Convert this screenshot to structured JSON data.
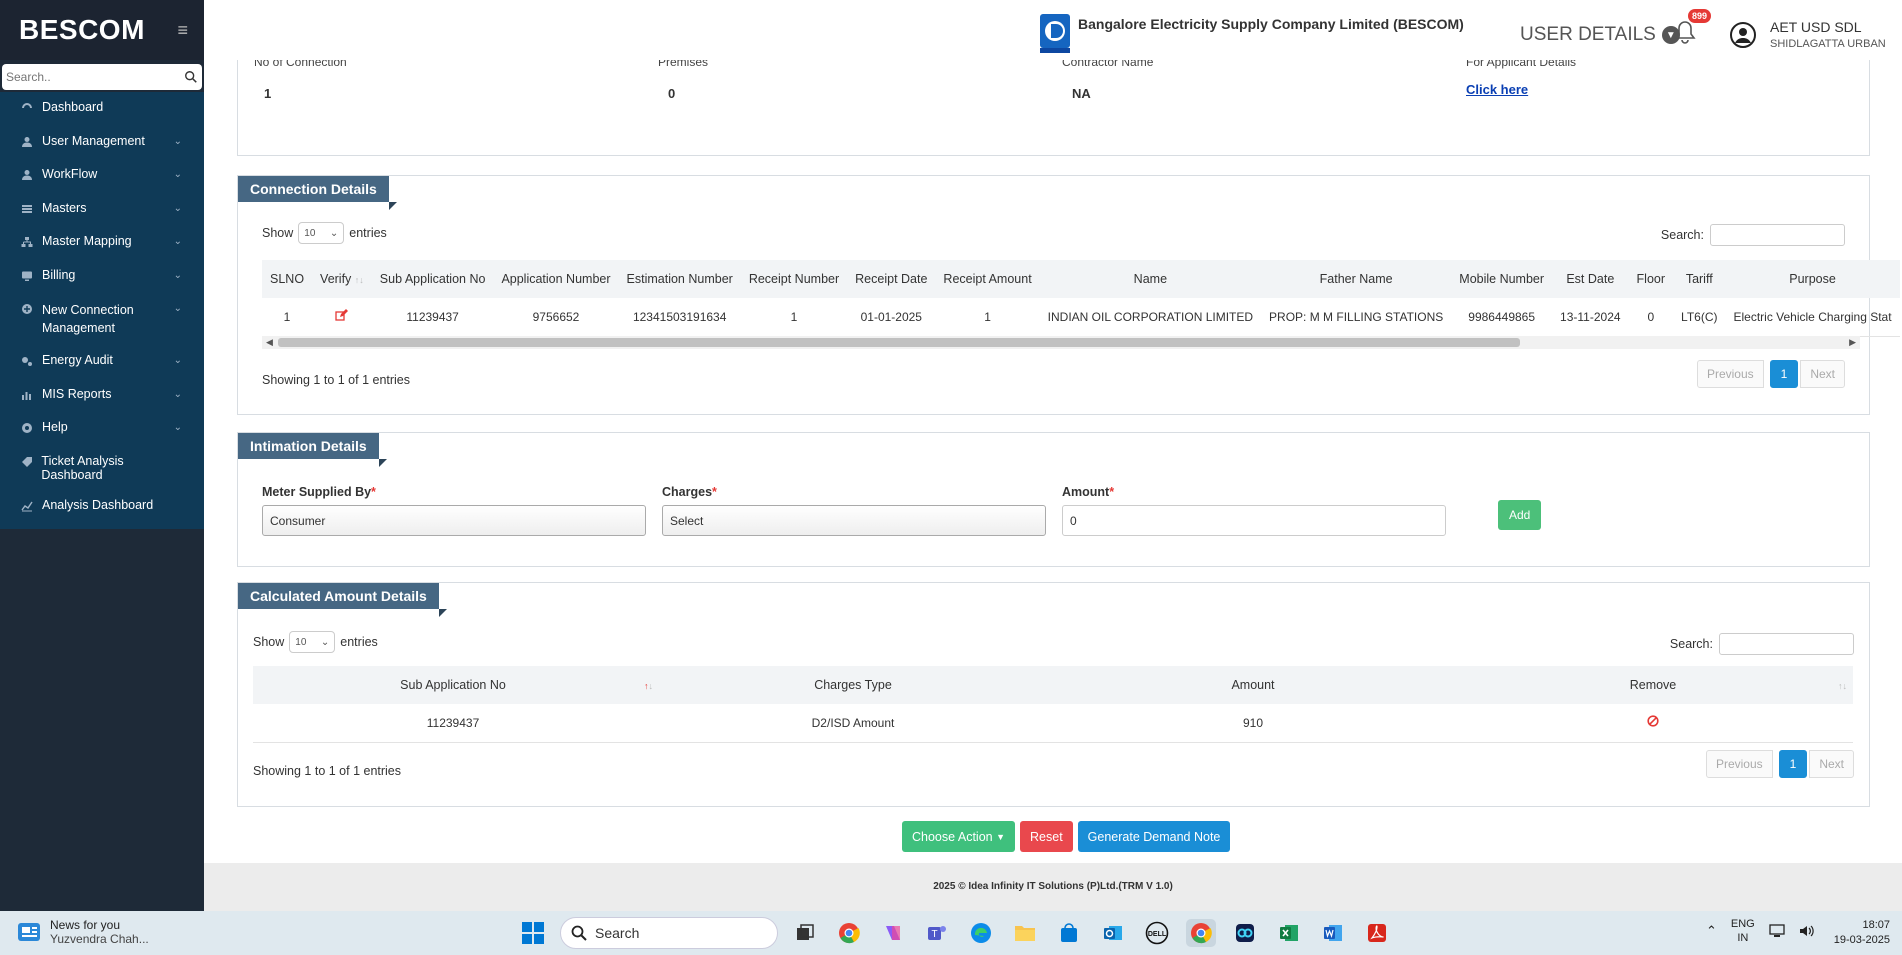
{
  "sidebar": {
    "brand": "BESCOM",
    "search_placeholder": "Search..",
    "items": [
      {
        "label": "Dashboard",
        "icon": "dashboard-icon",
        "chevron": false
      },
      {
        "label": "User Management",
        "icon": "user-icon",
        "chevron": true
      },
      {
        "label": "WorkFlow",
        "icon": "user-icon",
        "chevron": true
      },
      {
        "label": "Masters",
        "icon": "list-icon",
        "chevron": true
      },
      {
        "label": "Master Mapping",
        "icon": "sitemap-icon",
        "chevron": true
      },
      {
        "label": "Billing",
        "icon": "monitor-icon",
        "chevron": true
      },
      {
        "label": "New Connection Management",
        "icon": "plus-circle-icon",
        "chevron": true
      },
      {
        "label": "Energy Audit",
        "icon": "cogs-icon",
        "chevron": true
      },
      {
        "label": "MIS Reports",
        "icon": "bar-chart-icon",
        "chevron": true
      },
      {
        "label": "Help",
        "icon": "help-icon",
        "chevron": true
      },
      {
        "label": "Ticket Analysis Dashboard",
        "icon": "tag-icon",
        "chevron": false
      },
      {
        "label": "Analysis Dashboard",
        "icon": "line-chart-icon",
        "chevron": false
      }
    ]
  },
  "header": {
    "company": "Bangalore Electricity Supply Company Limited (BESCOM)",
    "user_details": "USER DETAILS",
    "notification_count": "899",
    "user_name": "AET USD SDL",
    "user_location": "SHIDLAGATTA URBAN"
  },
  "info": {
    "no_of_connection_label": "No of Connection",
    "no_of_connection": "1",
    "premises_label": "Premises",
    "premises": "0",
    "contractor_label": "Contractor Name",
    "contractor": "NA",
    "applicant_label": "For Applicant Details",
    "applicant_link": "Click here"
  },
  "connection": {
    "title": "Connection Details",
    "show": "Show",
    "entries_value": "10",
    "entries": "entries",
    "search": "Search:",
    "columns": [
      "SLNO",
      "Verify",
      "Sub Application No",
      "Application Number",
      "Estimation Number",
      "Receipt Number",
      "Receipt Date",
      "Receipt Amount",
      "Name",
      "Father Name",
      "Mobile Number",
      "Est Date",
      "Floor",
      "Tariff",
      "Purpose"
    ],
    "row": {
      "slno": "1",
      "sub_app": "11239437",
      "app_no": "9756652",
      "est_no": "12341503191634",
      "receipt_no": "1",
      "receipt_date": "01-01-2025",
      "receipt_amount": "1",
      "name": "INDIAN OIL CORPORATION LIMITED",
      "father": "PROP: M M FILLING STATIONS",
      "mobile": "9986449865",
      "est_date": "13-11-2024",
      "floor": "0",
      "tariff": "LT6(C)",
      "purpose": "Electric Vehicle Charging Stat"
    },
    "showing": "Showing 1 to 1 of 1 entries",
    "prev": "Previous",
    "page": "1",
    "next": "Next"
  },
  "intimation": {
    "title": "Intimation Details",
    "meter_label": "Meter Supplied By",
    "meter_value": "Consumer",
    "charges_label": "Charges",
    "charges_value": "Select",
    "amount_label": "Amount",
    "amount_value": "0",
    "add": "Add"
  },
  "calculated": {
    "title": "Calculated Amount Details",
    "show": "Show",
    "entries_value": "10",
    "entries": "entries",
    "search": "Search:",
    "columns": [
      "Sub Application No",
      "Charges Type",
      "Amount",
      "Remove"
    ],
    "row": {
      "sub_app": "11239437",
      "charges_type": "D2/ISD Amount",
      "amount": "910"
    },
    "showing": "Showing 1 to 1 of 1 entries",
    "prev": "Previous",
    "page": "1",
    "next": "Next"
  },
  "actions": {
    "choose": "Choose Action",
    "reset": "Reset",
    "generate": "Generate Demand Note"
  },
  "footer": "2025 © Idea Infinity IT Solutions (P)Ltd.(TRM V 1.0)",
  "taskbar": {
    "news_title": "News for you",
    "news_sub": "Yuzvendra Chah...",
    "search": "Search",
    "lang1": "ENG",
    "lang2": "IN",
    "time": "18:07",
    "date": "19-03-2025"
  },
  "colors": {
    "sidebar": "#1e2a38",
    "nav": "#0f3a57",
    "card_title": "#466783",
    "primary": "#1a8ed6",
    "success": "#3fc07d",
    "danger": "#e9484d"
  }
}
